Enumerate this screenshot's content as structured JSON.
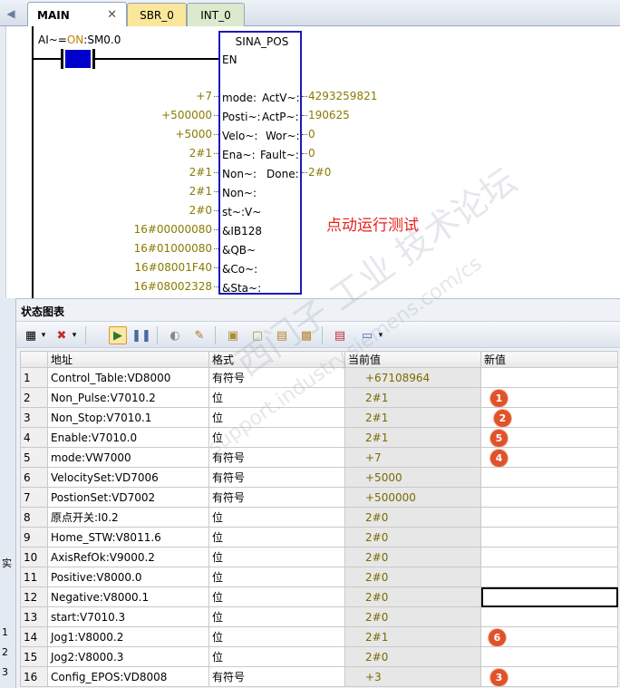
{
  "tabs": [
    {
      "label": "MAIN",
      "active": true
    },
    {
      "label": "SBR_0"
    },
    {
      "label": "INT_0"
    }
  ],
  "ladder": {
    "contact_label_prefix": "AI~=",
    "contact_label_on": "ON",
    "contact_label_suffix": ":SM0.0",
    "block_title": "SINA_POS",
    "en": "EN",
    "inputs": [
      {
        "value": "+7",
        "pin": "mode:"
      },
      {
        "value": "+500000",
        "pin": "Posti~:"
      },
      {
        "value": "+5000",
        "pin": "Velo~:"
      },
      {
        "value": "2#1",
        "pin": "Ena~:"
      },
      {
        "value": "2#1",
        "pin": "Non~:"
      },
      {
        "value": "2#1",
        "pin": "Non~:"
      },
      {
        "value": "2#0",
        "pin": "st~:V~"
      },
      {
        "value": "16#00000080",
        "pin": "&IB128"
      },
      {
        "value": "16#01000080",
        "pin": "&QB~"
      },
      {
        "value": "16#08001F40",
        "pin": "&Co~:"
      },
      {
        "value": "16#08002328",
        "pin": "&Sta~:"
      }
    ],
    "outputs": [
      {
        "pin": "ActV~:",
        "value": "4293259821"
      },
      {
        "pin": "ActP~:",
        "value": "190625"
      },
      {
        "pin": "Wor~:",
        "value": "0"
      },
      {
        "pin": "Fault~:",
        "value": "0"
      },
      {
        "pin": "Done:",
        "value": "2#0"
      }
    ],
    "annotation": "点动运行测试",
    "watermark": "西门子 工业 技术论坛",
    "watermark_url": "support.industry.siemens.com/cs"
  },
  "status_chart": {
    "title": "状态图表",
    "columns": [
      "",
      "地址",
      "格式",
      "当前值",
      "新值"
    ],
    "rows": [
      {
        "n": "1",
        "addr": "Control_Table:VD8000",
        "fmt": "有符号",
        "cur": "+67108964",
        "badge": ""
      },
      {
        "n": "2",
        "addr": "Non_Pulse:V7010.2",
        "fmt": "位",
        "cur": "2#1",
        "badge": "1"
      },
      {
        "n": "3",
        "addr": "Non_Stop:V7010.1",
        "fmt": "位",
        "cur": "2#1",
        "badge": "2"
      },
      {
        "n": "4",
        "addr": "Enable:V7010.0",
        "fmt": "位",
        "cur": "2#1",
        "badge": "5"
      },
      {
        "n": "5",
        "addr": "mode:VW7000",
        "fmt": "有符号",
        "cur": "+7",
        "badge": "4"
      },
      {
        "n": "6",
        "addr": "VelocitySet:VD7006",
        "fmt": "有符号",
        "cur": "+5000",
        "badge": ""
      },
      {
        "n": "7",
        "addr": "PostionSet:VD7002",
        "fmt": "有符号",
        "cur": "+500000",
        "badge": ""
      },
      {
        "n": "8",
        "addr": "原点开关:I0.2",
        "fmt": "位",
        "cur": "2#0",
        "badge": ""
      },
      {
        "n": "9",
        "addr": "Home_STW:V8011.6",
        "fmt": "位",
        "cur": "2#0",
        "badge": ""
      },
      {
        "n": "10",
        "addr": "AxisRefOk:V9000.2",
        "fmt": "位",
        "cur": "2#0",
        "badge": ""
      },
      {
        "n": "11",
        "addr": "Positive:V8000.0",
        "fmt": "位",
        "cur": "2#0",
        "badge": ""
      },
      {
        "n": "12",
        "addr": "Negative:V8000.1",
        "fmt": "位",
        "cur": "2#0",
        "badge": ""
      },
      {
        "n": "13",
        "addr": "start:V7010.3",
        "fmt": "位",
        "cur": "2#0",
        "badge": ""
      },
      {
        "n": "14",
        "addr": "Jog1:V8000.2",
        "fmt": "位",
        "cur": "2#1",
        "badge": "6"
      },
      {
        "n": "15",
        "addr": "Jog2:V8000.3",
        "fmt": "位",
        "cur": "2#0",
        "badge": ""
      },
      {
        "n": "16",
        "addr": "Config_EPOS:VD8008",
        "fmt": "有符号",
        "cur": "+3",
        "badge": "3"
      }
    ]
  },
  "left_stub": [
    "实",
    "1",
    "2",
    "3"
  ]
}
